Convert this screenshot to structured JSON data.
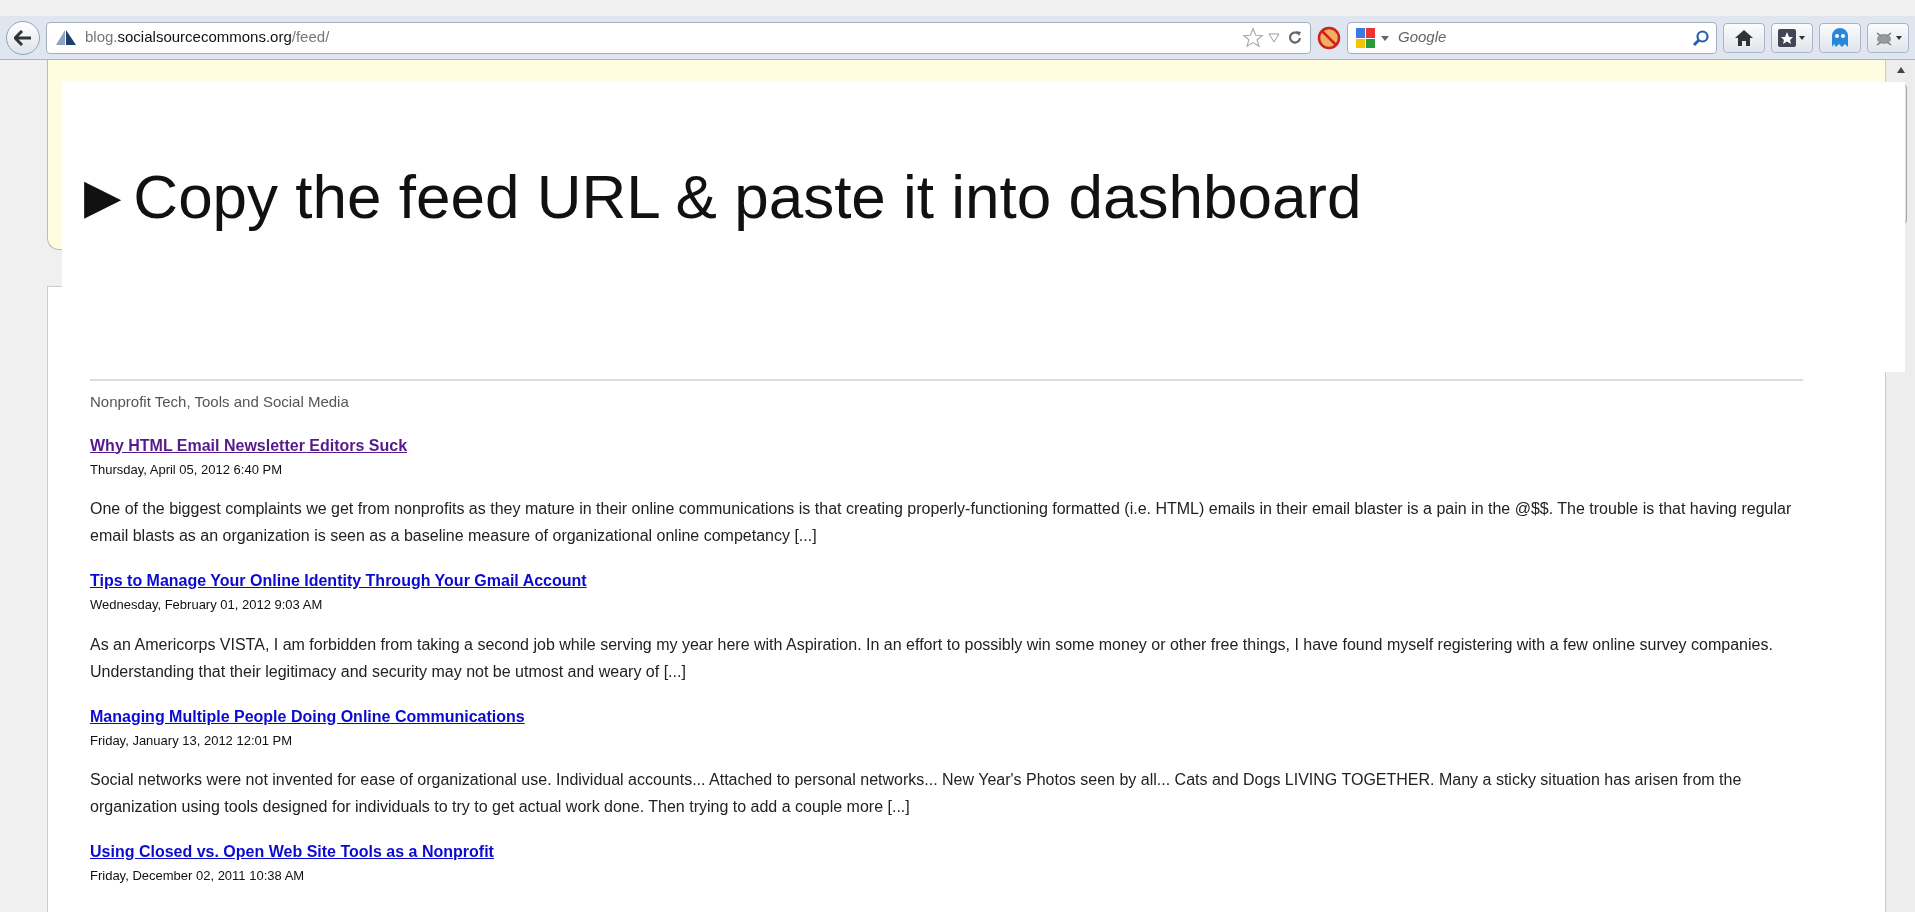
{
  "toolbar": {
    "url": {
      "prefix": "blog.",
      "host": "socialsourcecommons.org",
      "path": "/feed/"
    },
    "search": {
      "placeholder": "Google"
    }
  },
  "banner": {
    "text": "►Copy the feed URL & paste it into dashboard"
  },
  "feed": {
    "subtitle": "Nonprofit Tech, Tools and Social Media",
    "posts": [
      {
        "title": "Why HTML Email Newsletter Editors Suck",
        "visited": true,
        "date": "Thursday, April 05, 2012 6:40 PM",
        "excerpt": "One of the biggest complaints we get from nonprofits as they mature in their online communications is that creating properly-functioning formatted (i.e. HTML) emails in their email blaster is a pain in the @$$. The trouble is that having regular email blasts as an organization is seen as a baseline measure of organizational online competancy [...]"
      },
      {
        "title": "Tips to Manage Your Online Identity Through Your Gmail Account",
        "visited": false,
        "date": "Wednesday, February 01, 2012 9:03 AM",
        "excerpt": "As an Americorps VISTA, I am forbidden from taking a second job while serving my year here with Aspiration. In an effort to possibly win some money or other free things, I have found myself registering with a few online survey companies. Understanding that their legitimacy and security may not be utmost and weary of [...]"
      },
      {
        "title": "Managing Multiple People Doing Online Communications",
        "visited": false,
        "date": "Friday, January 13, 2012 12:01 PM",
        "excerpt": "Social networks were not invented for ease of organizational use. Individual accounts... Attached to personal networks... New Year's Photos seen by all... Cats and Dogs LIVING TOGETHER. Many a sticky situation has arisen from the organization using tools designed for individuals to try to get actual work done. Then trying to add a couple more [...]"
      },
      {
        "title": "Using Closed vs. Open Web Site Tools as a Nonprofit",
        "visited": false,
        "date": "Friday, December 02, 2011 10:38 AM"
      }
    ]
  }
}
